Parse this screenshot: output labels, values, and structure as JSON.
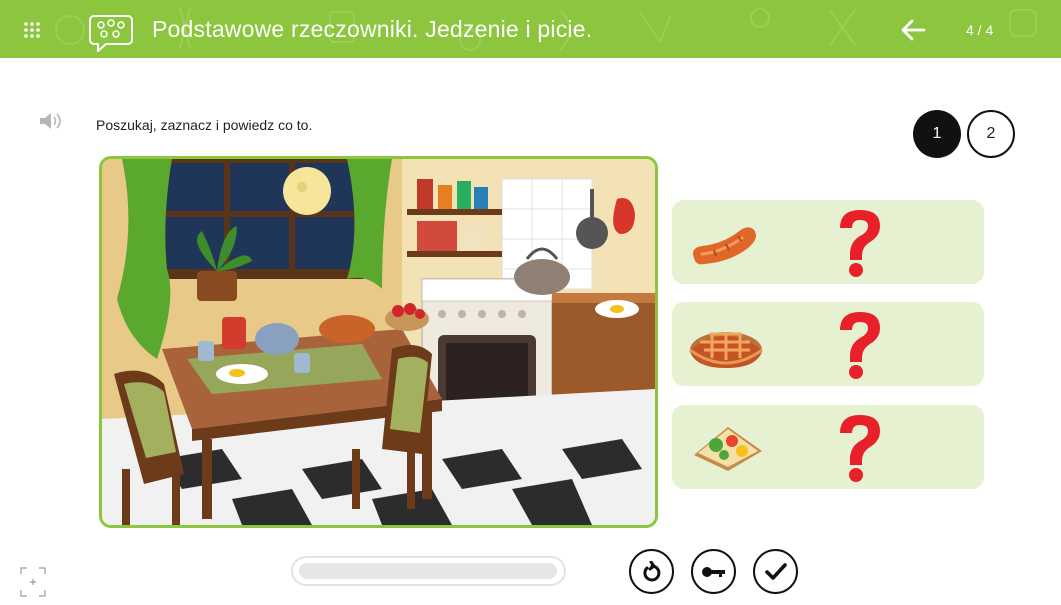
{
  "header": {
    "title": "Podstawowe rzeczowniki. Jedzenie i picie.",
    "page_counter": "4 / 4",
    "bar_color": "#8cc63f"
  },
  "exercise": {
    "instruction": "Poszukaj, zaznacz i powiedz co to.",
    "steps": [
      "1",
      "2"
    ],
    "active_step": "1"
  },
  "cards": [
    {
      "item_icon": "sausage-icon",
      "hidden": "question-mark-icon"
    },
    {
      "item_icon": "pie-icon",
      "hidden": "question-mark-icon"
    },
    {
      "item_icon": "sandwich-icon",
      "hidden": "question-mark-icon"
    }
  ],
  "progress": {
    "value": 0
  },
  "controls": [
    "reset-icon",
    "key-icon",
    "check-icon"
  ],
  "colors": {
    "accent": "#8cc63f",
    "card_bg": "#e5f1d0",
    "question": "#e8202a"
  }
}
